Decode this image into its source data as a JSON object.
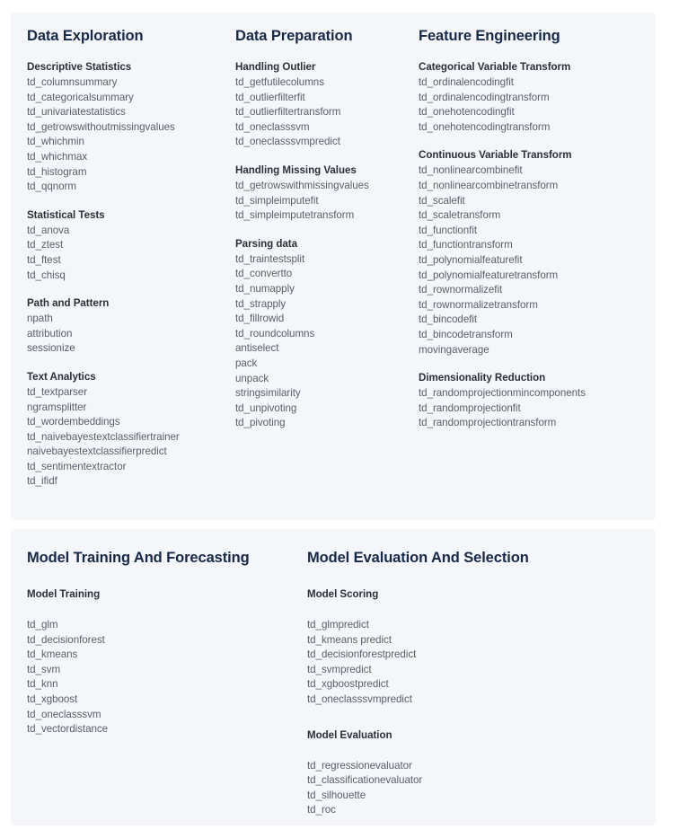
{
  "theme": {
    "page_background": "#ffffff",
    "card_background": "#f5f6fa",
    "section_title_color": "#162949",
    "group_title_color": "#2c3038",
    "item_color": "#5a5f6a"
  },
  "cards": [
    {
      "name": "analytics-functions-card",
      "columns": [
        {
          "name": "data-exploration",
          "title": "Data Exploration",
          "groups": [
            {
              "title": "Descriptive Statistics",
              "items": [
                "td_columnsummary",
                "td_categoricalsummary",
                "td_univariatestatistics",
                "td_getrowswithoutmissingvalues",
                "td_whichmin",
                "td_whichmax",
                "td_histogram",
                "td_qqnorm"
              ]
            },
            {
              "title": "Statistical Tests",
              "items": [
                "td_anova",
                "td_ztest",
                "td_ftest",
                "td_chisq"
              ]
            },
            {
              "title": "Path and Pattern",
              "items": [
                "npath",
                "attribution",
                "sessionize"
              ]
            },
            {
              "title": "Text Analytics",
              "items": [
                "td_textparser",
                "ngramsplitter",
                "td_wordembeddings",
                "td_naivebayestextclassifiertrainer",
                "naivebayestextclassifierpredict",
                "td_sentimentextractor",
                "td_ifidf"
              ]
            }
          ]
        },
        {
          "name": "data-preparation",
          "title": "Data Preparation",
          "groups": [
            {
              "title": "Handling Outlier",
              "items": [
                "td_getfutilecolumns",
                "td_outlierfilterfit",
                "td_outlierfiltertransform",
                "td_oneclasssvm",
                "td_oneclasssvmpredict"
              ]
            },
            {
              "title": "Handling Missing Values",
              "items": [
                "td_getrowswithmissingvalues",
                "td_simpleimputefit",
                "td_simpleimputetransform"
              ]
            },
            {
              "title": "Parsing data",
              "items": [
                "td_traintestsplit",
                "td_convertto",
                "td_numapply",
                "td_strapply",
                "td_fillrowid",
                "td_roundcolumns",
                "antiselect",
                "pack",
                "unpack",
                "stringsimilarity",
                "td_unpivoting",
                "td_pivoting"
              ]
            }
          ]
        },
        {
          "name": "feature-engineering",
          "title": "Feature Engineering",
          "groups": [
            {
              "title": "Categorical Variable Transform",
              "items": [
                "td_ordinalencodingfit",
                "td_ordinalencodingtransform",
                "td_onehotencodingfit",
                "td_onehotencodingtransform"
              ]
            },
            {
              "title": "Continuous Variable Transform",
              "items": [
                "td_nonlinearcombinefit",
                "td_nonlinearcombinetransform",
                "td_scalefit",
                "td_scaletransform",
                "td_functionfit",
                "td_functiontransform",
                "td_polynomialfeaturefit",
                "td_polynomialfeaturetransform",
                "td_rownormalizefit",
                "td_rownormalizetransform",
                "td_bincodefit",
                "td_bincodetransform",
                "movingaverage"
              ]
            },
            {
              "title": "Dimensionality Reduction",
              "items": [
                "td_randomprojectionmincomponents",
                "td_randomprojectionfit",
                "td_randomprojectiontransform"
              ]
            }
          ]
        }
      ]
    },
    {
      "name": "modeling-functions-card",
      "columns": [
        {
          "name": "model-training-and-forecasting",
          "title": "Model Training And Forecasting",
          "groups": [
            {
              "title": "Model Training",
              "items": [
                "td_glm",
                "td_decisionforest",
                "td_kmeans",
                "td_svm",
                "td_knn",
                "td_xgboost",
                "td_oneclasssvm",
                "td_vectordistance"
              ]
            }
          ]
        },
        {
          "name": "model-evaluation-and-selection",
          "title": "Model Evaluation And Selection",
          "groups": [
            {
              "title": "Model Scoring",
              "items": [
                "td_glmpredict",
                "td_kmeans predict",
                "td_decisionforestpredict",
                "td_svmpredict",
                "td_xgboostpredict",
                "td_oneclasssvmpredict"
              ]
            },
            {
              "title": "Model Evaluation",
              "items": [
                "td_regressionevaluator",
                "td_classificationevaluator",
                "td_silhouette",
                "td_roc"
              ]
            }
          ]
        }
      ]
    }
  ]
}
